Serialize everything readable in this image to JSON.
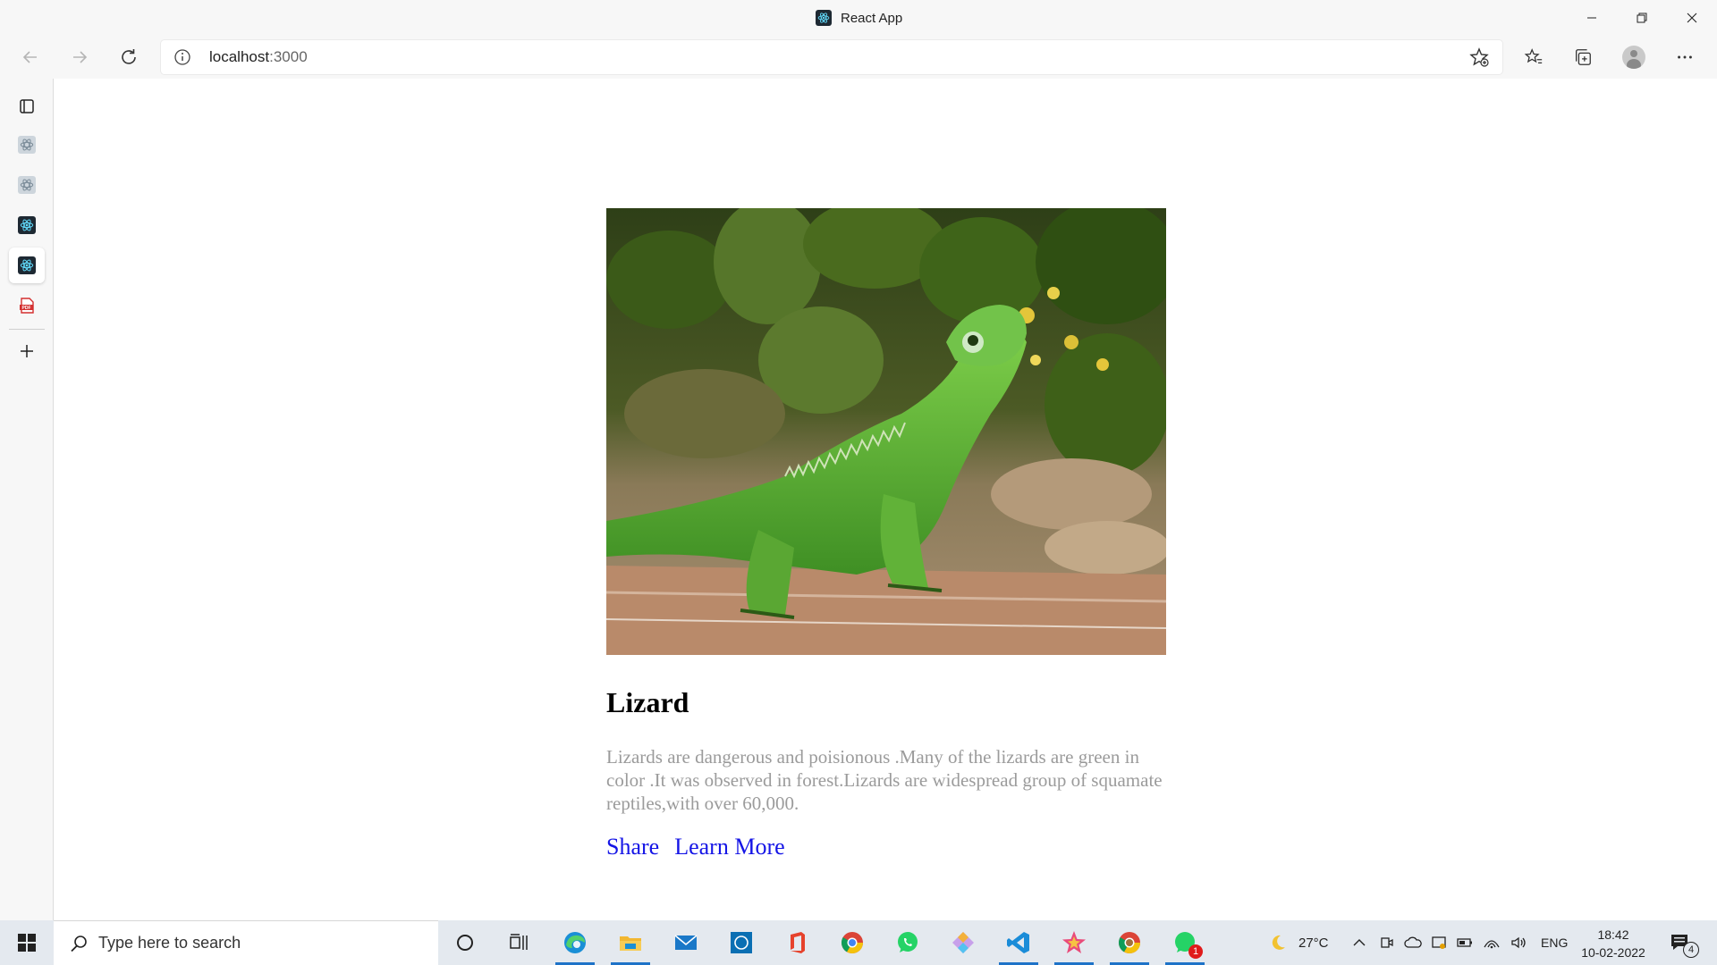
{
  "window": {
    "title": "React App"
  },
  "browser": {
    "url_host": "localhost",
    "url_port": ":3000"
  },
  "sidebar": {
    "tabs": [
      {
        "name": "tab-actions",
        "icon": "tab-actions-icon"
      },
      {
        "name": "react-tab-1",
        "icon": "react-icon"
      },
      {
        "name": "react-tab-2",
        "icon": "react-icon"
      },
      {
        "name": "react-tab-3",
        "icon": "react-icon"
      },
      {
        "name": "react-tab-4-active",
        "icon": "react-icon"
      },
      {
        "name": "pdf-tab",
        "icon": "pdf-icon"
      }
    ]
  },
  "card": {
    "title": "Lizard",
    "text": "Lizards are dangerous and poisionous .Many of the lizards are green in color .It was observed in forest.Lizards are widespread group of squamate reptiles,with over 60,000.",
    "share_label": "Share",
    "learn_more_label": "Learn More",
    "image_subject": "green iguana on a log"
  },
  "taskbar": {
    "search_placeholder": "Type here to search",
    "weather_temp": "27°C",
    "language": "ENG",
    "time": "18:42",
    "date": "10-02-2022",
    "notification_count": "4",
    "whatsapp_badge": "1"
  },
  "colors": {
    "link": "#1515e6",
    "body_text_muted": "#9b9b9b",
    "chrome_bg": "#f7f7f7",
    "taskbar_bg": "#e4e9ef"
  }
}
